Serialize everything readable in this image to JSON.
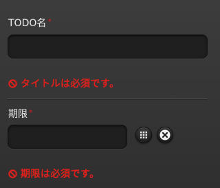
{
  "form": {
    "title_field": {
      "label": "TODO名",
      "required_mark": "*",
      "value": "",
      "error": "タイトルは必須です。"
    },
    "deadline_field": {
      "label": "期限",
      "required_mark": "*",
      "value": "",
      "error": "期限は必須です。",
      "calendar_button_icon": "calendar-grid-icon",
      "clear_button_icon": "clear-x-icon"
    }
  },
  "colors": {
    "error": "#e0201c",
    "required": "#d42020",
    "input_background": "#1f1f1f",
    "page_background": "#363636"
  }
}
